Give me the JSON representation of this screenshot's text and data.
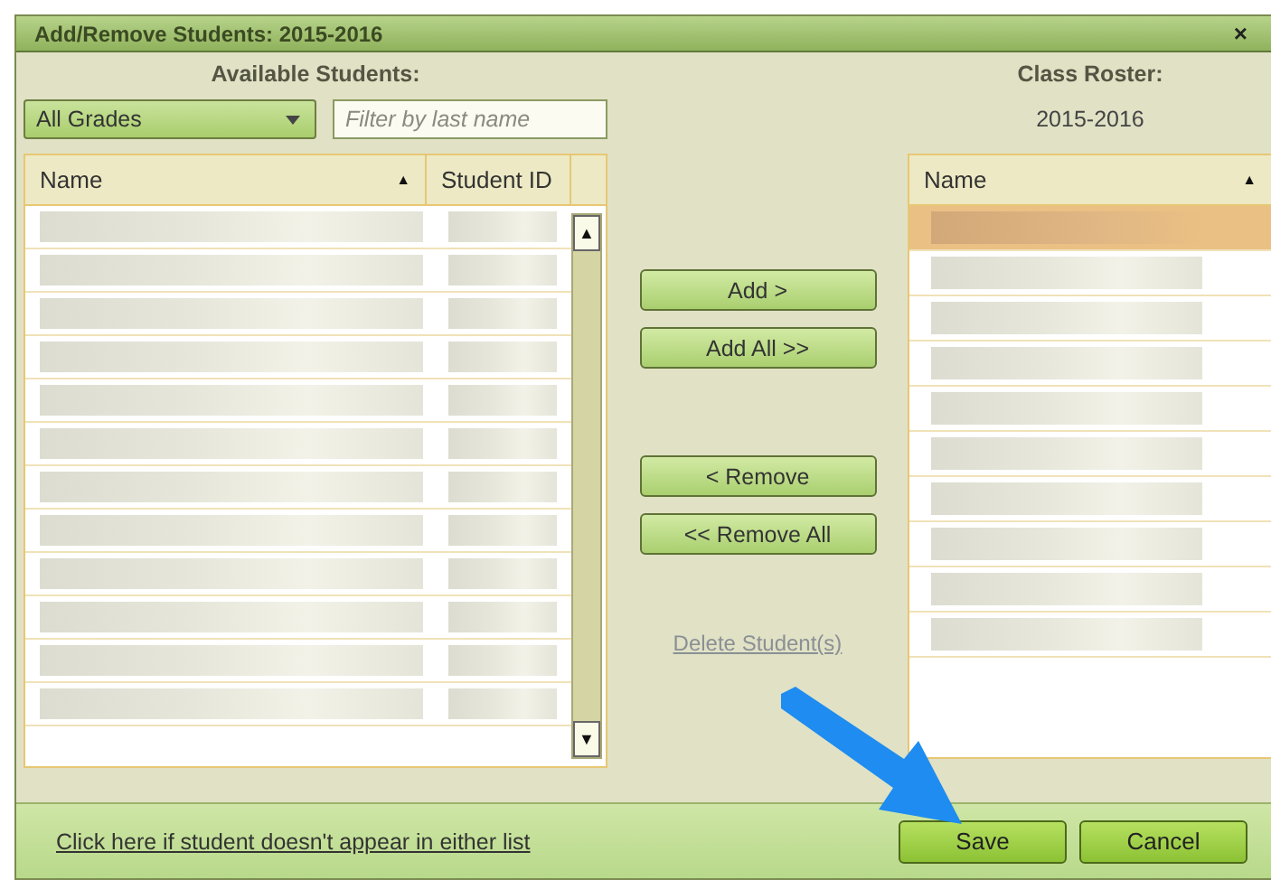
{
  "window": {
    "title": "Add/Remove Students: 2015-2016",
    "close": "×"
  },
  "available": {
    "heading": "Available Students:",
    "grade_select": "All Grades",
    "filter": {
      "placeholder": "Filter by last name"
    },
    "columns": [
      {
        "label": "Name",
        "sort": "▲"
      },
      {
        "label": "Student ID"
      }
    ],
    "rows": [
      {
        "selected": false
      },
      {
        "selected": false
      },
      {
        "selected": false
      },
      {
        "selected": false
      },
      {
        "selected": false
      },
      {
        "selected": false
      },
      {
        "selected": false
      },
      {
        "selected": false
      },
      {
        "selected": false
      },
      {
        "selected": false
      },
      {
        "selected": false
      },
      {
        "selected": false
      }
    ],
    "scroll_up": "▲",
    "scroll_down": "▼"
  },
  "actions": [
    {
      "label": "Add >",
      "disabled": false
    },
    {
      "label": "Add All >>",
      "disabled": false
    },
    {
      "label": "< Remove",
      "disabled": false
    },
    {
      "label": "<< Remove All",
      "disabled": false
    }
  ],
  "delete_link": {
    "label": "Delete Student(s)",
    "disabled": true
  },
  "roster": {
    "heading": "Class Roster:",
    "year": "2015-2016",
    "columns": [
      {
        "label": "Name",
        "sort": "▲"
      }
    ],
    "rows": [
      {
        "selected": true
      },
      {
        "selected": false
      },
      {
        "selected": false
      },
      {
        "selected": false
      },
      {
        "selected": false
      },
      {
        "selected": false
      },
      {
        "selected": false
      },
      {
        "selected": false
      },
      {
        "selected": false
      },
      {
        "selected": false
      }
    ]
  },
  "footer": {
    "link": "Click here if student doesn't appear in either list",
    "buttons": [
      "Save",
      "Cancel"
    ]
  }
}
